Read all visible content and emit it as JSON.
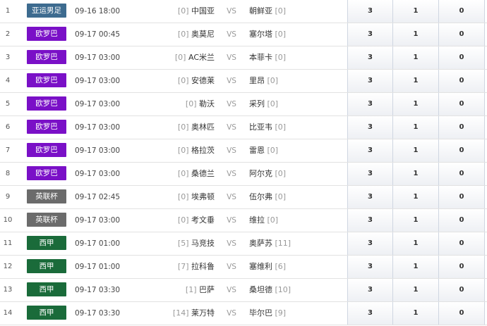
{
  "colors": {
    "亚运男足": "#3d6b8f",
    "欧罗巴": "#7a10c7",
    "英联杯": "#6b6b6b",
    "西甲": "#1a6b3a"
  },
  "matches": [
    {
      "index": "1",
      "league": "亚运男足",
      "time": "09-16 18:00",
      "home_rank": "[0]",
      "home": "中国亚",
      "vs": "VS",
      "away": "朝鲜亚",
      "away_rank": "[0]",
      "odds": [
        "3",
        "1",
        "0"
      ]
    },
    {
      "index": "2",
      "league": "欧罗巴",
      "time": "09-17 00:45",
      "home_rank": "[0]",
      "home": "奥莫尼",
      "vs": "VS",
      "away": "塞尔塔",
      "away_rank": "[0]",
      "odds": [
        "3",
        "1",
        "0"
      ]
    },
    {
      "index": "3",
      "league": "欧罗巴",
      "time": "09-17 03:00",
      "home_rank": "[0]",
      "home": "AC米兰",
      "vs": "VS",
      "away": "本菲卡",
      "away_rank": "[0]",
      "odds": [
        "3",
        "1",
        "0"
      ]
    },
    {
      "index": "4",
      "league": "欧罗巴",
      "time": "09-17 03:00",
      "home_rank": "[0]",
      "home": "安德莱",
      "vs": "VS",
      "away": "里昂",
      "away_rank": "[0]",
      "odds": [
        "3",
        "1",
        "0"
      ]
    },
    {
      "index": "5",
      "league": "欧罗巴",
      "time": "09-17 03:00",
      "home_rank": "[0]",
      "home": "勒沃",
      "vs": "VS",
      "away": "采列",
      "away_rank": "[0]",
      "odds": [
        "3",
        "1",
        "0"
      ]
    },
    {
      "index": "6",
      "league": "欧罗巴",
      "time": "09-17 03:00",
      "home_rank": "[0]",
      "home": "奥林匹",
      "vs": "VS",
      "away": "比亚韦",
      "away_rank": "[0]",
      "odds": [
        "3",
        "1",
        "0"
      ]
    },
    {
      "index": "7",
      "league": "欧罗巴",
      "time": "09-17 03:00",
      "home_rank": "[0]",
      "home": "格拉茨",
      "vs": "VS",
      "away": "雷恩",
      "away_rank": "[0]",
      "odds": [
        "3",
        "1",
        "0"
      ]
    },
    {
      "index": "8",
      "league": "欧罗巴",
      "time": "09-17 03:00",
      "home_rank": "[0]",
      "home": "桑德兰",
      "vs": "VS",
      "away": "阿尔克",
      "away_rank": "[0]",
      "odds": [
        "3",
        "1",
        "0"
      ]
    },
    {
      "index": "9",
      "league": "英联杯",
      "time": "09-17 02:45",
      "home_rank": "[0]",
      "home": "埃弗顿",
      "vs": "VS",
      "away": "伍尔弗",
      "away_rank": "[0]",
      "odds": [
        "3",
        "1",
        "0"
      ]
    },
    {
      "index": "10",
      "league": "英联杯",
      "time": "09-17 03:00",
      "home_rank": "[0]",
      "home": "考文垂",
      "vs": "VS",
      "away": "维拉",
      "away_rank": "[0]",
      "odds": [
        "3",
        "1",
        "0"
      ]
    },
    {
      "index": "11",
      "league": "西甲",
      "time": "09-17 01:00",
      "home_rank": "[5]",
      "home": "马竞技",
      "vs": "VS",
      "away": "奥萨苏",
      "away_rank": "[11]",
      "odds": [
        "3",
        "1",
        "0"
      ]
    },
    {
      "index": "12",
      "league": "西甲",
      "time": "09-17 01:00",
      "home_rank": "[7]",
      "home": "拉科鲁",
      "vs": "VS",
      "away": "塞维利",
      "away_rank": "[6]",
      "odds": [
        "3",
        "1",
        "0"
      ]
    },
    {
      "index": "13",
      "league": "西甲",
      "time": "09-17 03:30",
      "home_rank": "[1]",
      "home": "巴萨",
      "vs": "VS",
      "away": "桑坦德",
      "away_rank": "[10]",
      "odds": [
        "3",
        "1",
        "0"
      ]
    },
    {
      "index": "14",
      "league": "西甲",
      "time": "09-17 03:30",
      "home_rank": "[14]",
      "home": "莱万特",
      "vs": "VS",
      "away": "毕尔巴",
      "away_rank": "[9]",
      "odds": [
        "3",
        "1",
        "0"
      ]
    }
  ]
}
